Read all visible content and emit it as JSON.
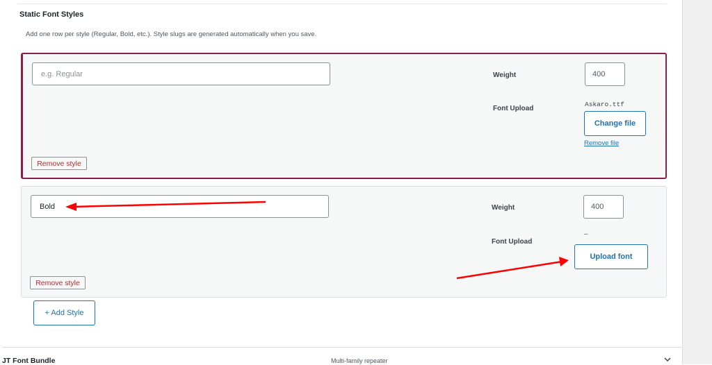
{
  "section": {
    "title": "Static Font Styles",
    "description": "Add one row per style (Regular, Bold, etc.). Style slugs are generated automatically when you save."
  },
  "rows": [
    {
      "name_value": "",
      "name_placeholder": "e.g. Regular",
      "weight_label": "Weight",
      "weight_value": "400",
      "upload_label": "Font Upload",
      "file_name": "Askaro.ttf",
      "change_file_label": "Change file",
      "remove_file_label": "Remove file",
      "remove_style_label": "Remove style"
    },
    {
      "name_value": "Bold",
      "name_placeholder": "",
      "weight_label": "Weight",
      "weight_value": "400",
      "upload_label": "Font Upload",
      "file_name": "–",
      "upload_font_label": "Upload font",
      "remove_style_label": "Remove style"
    }
  ],
  "add_style_label": "+ Add Style",
  "bundle": {
    "title": "JT Font Bundle",
    "subtitle": "Multi-family repeater"
  },
  "colors": {
    "accent": "#2271b1",
    "active_border": "#8c1d4b",
    "remove_text": "#b32d2e",
    "annotation_arrow": "#ff0000"
  },
  "icons": [
    "chevron-down-icon"
  ]
}
